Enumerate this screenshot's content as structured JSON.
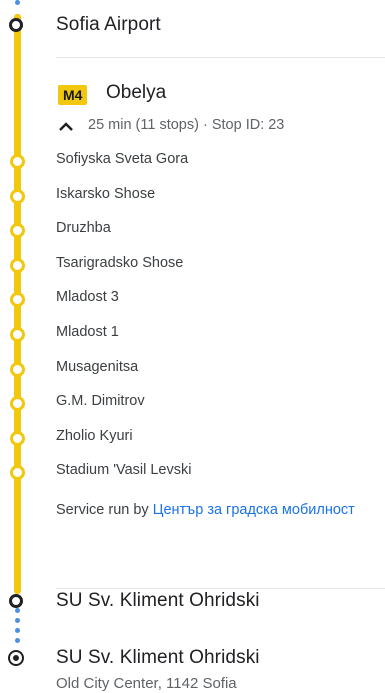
{
  "origin": {
    "name": "Sofia Airport"
  },
  "route": {
    "badge": "M4",
    "headsign": "Obelya",
    "summary": "25 min (11 stops) · Stop ID: 23",
    "color": "#f2c80f",
    "collapse_icon": "chevron-up-icon"
  },
  "stops": [
    "Sofiyska Sveta Gora",
    "Iskarsko Shose",
    "Druzhba",
    "Tsarigradsko Shose",
    "Mladost 3",
    "Mladost 1",
    "Musagenitsa",
    "G.M. Dimitrov",
    "Zholio Kyuri",
    "Stadium 'Vasil Levski"
  ],
  "service": {
    "prefix": "Service run by ",
    "operator": "Център за градска мобилност"
  },
  "alight": {
    "name": "SU Sv. Kliment Ohridski"
  },
  "destination": {
    "name": "SU Sv. Kliment Ohridski",
    "address": "Old City Center, 1142 Sofia"
  },
  "colors": {
    "walk_dots": "#4a90e2",
    "link": "#1a73e8"
  }
}
